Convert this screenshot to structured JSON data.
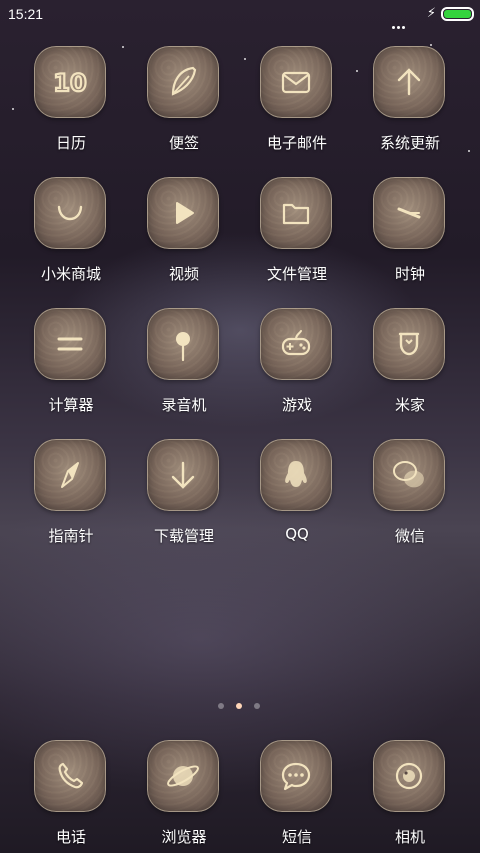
{
  "status_bar": {
    "time": "15:21",
    "battery_level": 1.0,
    "charging": true,
    "battery_color": "#34d33d"
  },
  "icons": [
    {
      "label": "日历",
      "icon": "calendar-icon",
      "glyph": "10"
    },
    {
      "label": "便签",
      "icon": "feather-icon"
    },
    {
      "label": "电子邮件",
      "icon": "mail-icon"
    },
    {
      "label": "系统更新",
      "icon": "arrow-up-icon"
    },
    {
      "label": "小米商城",
      "icon": "smile-icon"
    },
    {
      "label": "视频",
      "icon": "play-icon"
    },
    {
      "label": "文件管理",
      "icon": "folder-icon"
    },
    {
      "label": "时钟",
      "icon": "clock-icon"
    },
    {
      "label": "计算器",
      "icon": "equals-icon"
    },
    {
      "label": "录音机",
      "icon": "microphone-icon"
    },
    {
      "label": "游戏",
      "icon": "gamepad-icon"
    },
    {
      "label": "米家",
      "icon": "mijia-icon"
    },
    {
      "label": "指南针",
      "icon": "compass-icon"
    },
    {
      "label": "下载管理",
      "icon": "download-icon"
    },
    {
      "label": "QQ",
      "icon": "penguin-icon"
    },
    {
      "label": "微信",
      "icon": "wechat-icon"
    }
  ],
  "pager": {
    "total": 3,
    "active_index": 1
  },
  "dock": [
    {
      "label": "电话",
      "icon": "phone-icon"
    },
    {
      "label": "浏览器",
      "icon": "planet-icon"
    },
    {
      "label": "短信",
      "icon": "message-icon"
    },
    {
      "label": "相机",
      "icon": "camera-icon"
    }
  ],
  "colors": {
    "glyph": "#f2e3bf",
    "page_dot_active": "#ffd6b8"
  }
}
